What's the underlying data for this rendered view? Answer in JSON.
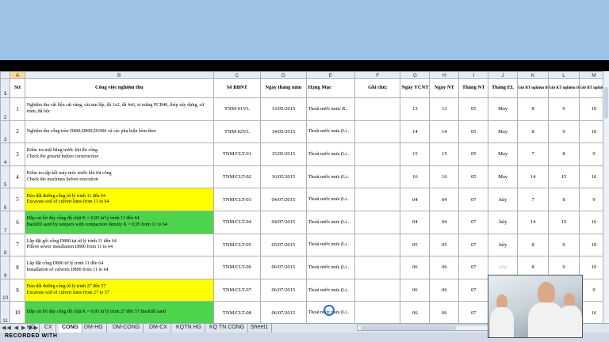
{
  "columns": [
    "A",
    "B",
    "C",
    "D",
    "E",
    "F",
    "G",
    "H",
    "I",
    "J",
    "K",
    "L",
    "M"
  ],
  "header": {
    "stt": "Stt",
    "work": "Công việc nghiệm thu",
    "bbnt": "Số BBNT",
    "date": "Ngày tháng năm",
    "category": "Hạng Mục",
    "note": "Ghi chú:",
    "day_ycnt": "Ngày YCNT",
    "day_nt": "Ngày NT",
    "month_nt": "Tháng NT",
    "month_el": "Tháng EL",
    "k": "Giờ BT nghiệm thu NB",
    "l": "Giờ KT nghiệm thu NB",
    "m": "Giờ BT nghiệm thu CV"
  },
  "rows": [
    {
      "rn": "2",
      "stt": "1",
      "vi": "Nghiệm thu vật liệu cát vàng, cát san lấp, đá 1x2, đá 4x6, xi măng PCB40, thép xây dựng, cừ tràm, đá hộc",
      "en": "",
      "en_italic": false,
      "fill": "",
      "bbnt": "TNM-01VL",
      "date": "13/05/2015",
      "cat": "Thoát nước mưa/ R..",
      "ycnt": "13",
      "nt": "13",
      "mnt": "05",
      "el": "May",
      "k": "8",
      "l": "9",
      "m": "10",
      "el_grey": false
    },
    {
      "rn": "3",
      "stt": "2",
      "vi": "Nghiệm thu cống tròn D400;D800;D1000 và các phụ kiện kèm theo",
      "en": "",
      "en_italic": false,
      "fill": "",
      "bbnt": "TNM-02VL",
      "date": "14/05/2015",
      "cat": "Thoát nước mưa (Li..",
      "ycnt": "14",
      "nt": "14",
      "mnt": "05",
      "el": "May",
      "k": "8",
      "l": "9",
      "m": "10",
      "el_grey": false
    },
    {
      "rn": "4",
      "stt": "3",
      "vi": "Kiểm tra mặt bằng trước khi thi công",
      "en": "Check the ground before construction",
      "en_italic": true,
      "fill": "",
      "bbnt": "TNM/CLT-01",
      "date": "15/05/2015",
      "cat": "Thoát nước mưa (Li..",
      "ycnt": "15",
      "nt": "15",
      "mnt": "05",
      "el": "May",
      "k": "7",
      "l": "8",
      "m": "9",
      "el_grey": false
    },
    {
      "rn": "5",
      "stt": "4",
      "vi": "Kiểm tra tập kết máy móc trước khi thi công",
      "en": "Check the machines before execution",
      "en_italic": false,
      "fill": "",
      "bbnt": "TNM/CLT-02",
      "date": "16/05/2015",
      "cat": "Thoát nước mưa (Li..",
      "ycnt": "16",
      "nt": "16",
      "mnt": "05",
      "el": "May",
      "k": "14",
      "l": "15",
      "m": "16",
      "el_grey": false
    },
    {
      "rn": "6",
      "stt": "5",
      "vi": "Đào đất đường cống từ lý trình 11 đến 64",
      "en": "Excavate soil of culvert lines from 11 to 64",
      "en_italic": false,
      "fill": "yellow",
      "bbnt": "TNM/CLT-03",
      "date": "04/07/2015",
      "cat": "Thoát nước mưa (Li..",
      "ycnt": "04",
      "nt": "04",
      "mnt": "07",
      "el": "July",
      "k": "7",
      "l": "8",
      "m": "9",
      "el_grey": false
    },
    {
      "rn": "7",
      "stt": "6",
      "vi": "Đắp cát lót đáy cống độ chặt K = 0,95 từ lý trình 11 đến 64",
      "en": "Backfill sand by tampers with compaction density K = 0,95 from 11 to 64",
      "en_italic": false,
      "fill": "green",
      "bbnt": "TNM/CLT-04",
      "date": "04/07/2015",
      "cat": "Thoát nước mưa (Li..",
      "ycnt": "04",
      "nt": "04",
      "mnt": "07",
      "el": "July",
      "k": "14",
      "l": "15",
      "m": "16",
      "el_grey": false
    },
    {
      "rn": "8",
      "stt": "7",
      "vi": "Lắp đặt gối cống D800 tại từ lý trình 11 đến 64",
      "en": "Pillow sewer installation D800 from 11 to 64",
      "en_italic": false,
      "fill": "",
      "bbnt": "TNM/CLT-05",
      "date": "05/07/2015",
      "cat": "Thoát nước mưa (Li..",
      "ycnt": "05",
      "nt": "05",
      "mnt": "07",
      "el": "July",
      "k": "8",
      "l": "9",
      "m": "10",
      "el_grey": false
    },
    {
      "rn": "9",
      "stt": "8",
      "vi": "Lắp đặt cống D800 từ lý trình 11 đến 64",
      "en": "Installation of culverts D800 from 11 to 64",
      "en_italic": false,
      "fill": "",
      "bbnt": "TNM/CLT-06",
      "date": "06/07/2015",
      "cat": "Thoát nước mưa (Li..",
      "ycnt": "06",
      "nt": "06",
      "mnt": "07",
      "el": "July",
      "k": "8",
      "l": "9",
      "m": "10",
      "el_grey": true
    },
    {
      "rn": "10",
      "stt": "9",
      "vi": "Đào đất đường cống từ lý trình 27 đến 57",
      "en": "Excavate soil of culvert lines from 27 to 57",
      "en_italic": false,
      "fill": "yellow",
      "bbnt": "TNM/CLT-07",
      "date": "06/07/2015",
      "cat": "Thoát nước mưa (Li..",
      "ycnt": "06",
      "nt": "06",
      "mnt": "07",
      "el": "July",
      "k": "7",
      "l": "8",
      "m": "9",
      "el_grey": false
    },
    {
      "rn": "11",
      "stt": "10",
      "vi": "Đắp cát lót đáy cống độ chặt K = 0,95 từ lý trình 27 đến 57 Backfill sand",
      "en": "",
      "en_italic": false,
      "fill": "green",
      "bbnt": "TNM/CLT-08",
      "date": "06/07/2015",
      "cat": "Thoát nước mưa (Li..",
      "ycnt": "06",
      "nt": "06",
      "mnt": "07",
      "el": "July",
      "k": "14",
      "l": "15",
      "m": "16",
      "el_grey": false
    }
  ],
  "tabs": [
    "HG",
    "CX",
    "CONG",
    "DM-HG",
    "DM-CONG",
    "DM-CX",
    "KQTN HG",
    "KQ TN CONG",
    "Sheet1"
  ],
  "active_tab": "CONG",
  "tab_nav": "◀◀ ◀ ▶ ▶▶",
  "status": "RECORDED WITH"
}
